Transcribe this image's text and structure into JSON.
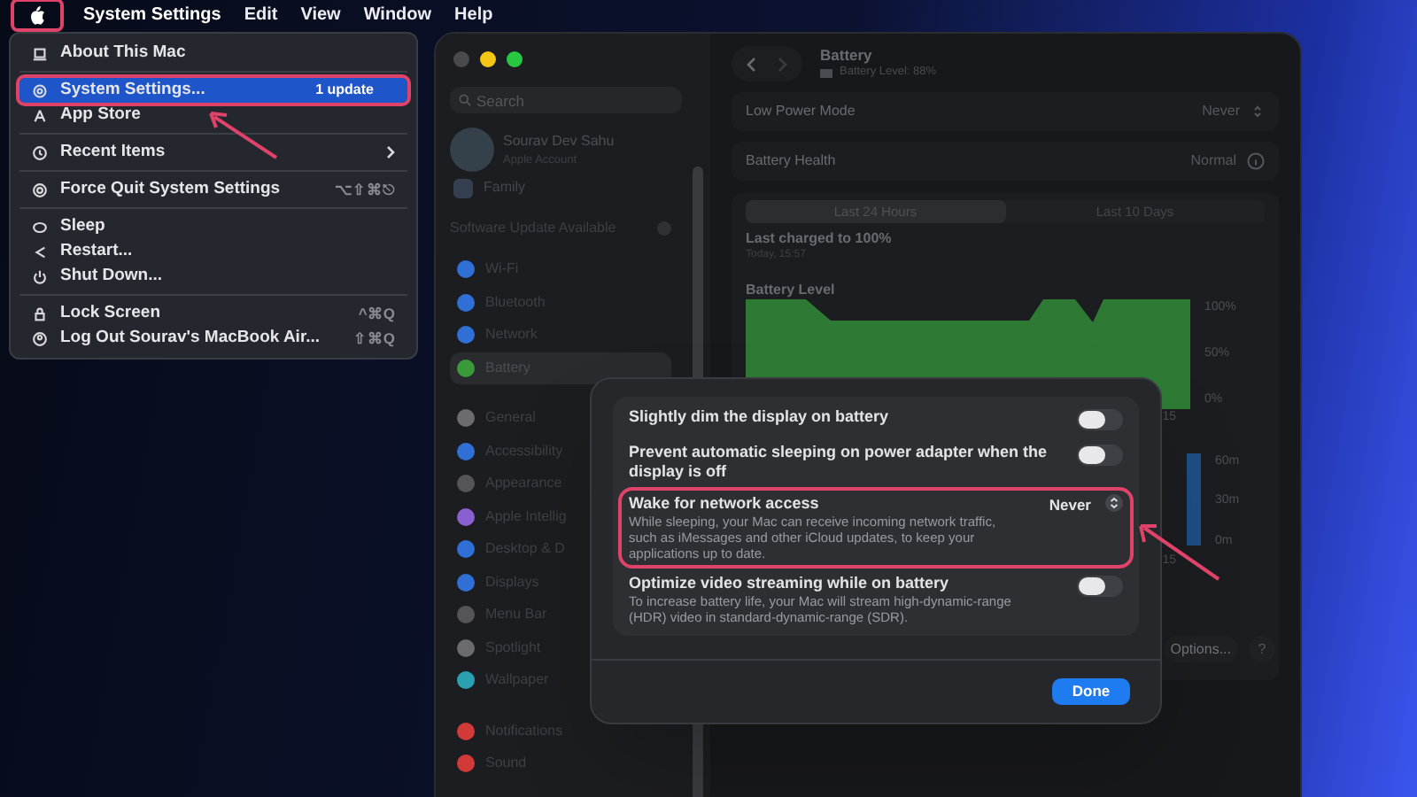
{
  "menu_bar": {
    "apple_highlighted": true,
    "items": [
      {
        "label": "System Settings",
        "kind": "app"
      },
      {
        "label": "Edit",
        "kind": "menu"
      },
      {
        "label": "View",
        "kind": "menu"
      },
      {
        "label": "Window",
        "kind": "menu"
      },
      {
        "label": "Help",
        "kind": "menu"
      }
    ]
  },
  "apple_menu": {
    "sections": [
      [
        {
          "label": "About This Mac",
          "selected": false,
          "highlighted": false
        }
      ],
      [
        {
          "label": "System Settings...",
          "badge": "1 update",
          "selected": true,
          "highlighted": true
        },
        {
          "label": "App Store",
          "selected": false,
          "highlighted": false
        }
      ],
      [
        {
          "label": "Recent Items",
          "submenu": true,
          "selected": false,
          "highlighted": false
        }
      ],
      [
        {
          "label": "Force Quit System Settings",
          "shortcut": "⌥⇧⌘⎋",
          "selected": false,
          "highlighted": false
        }
      ],
      [
        {
          "label": "Sleep",
          "selected": false,
          "highlighted": false
        },
        {
          "label": "Restart...",
          "selected": false,
          "highlighted": false
        },
        {
          "label": "Shut Down...",
          "selected": false,
          "highlighted": false
        }
      ],
      [
        {
          "label": "Lock Screen",
          "shortcut": "^⌘Q",
          "selected": false,
          "highlighted": false
        },
        {
          "label": "Log Out Sourav's MacBook Air...",
          "shortcut": "⇧⌘Q",
          "selected": false,
          "highlighted": false
        }
      ]
    ]
  },
  "settings_window": {
    "sidebar": {
      "search": {
        "placeholder": "Search"
      },
      "account": {
        "name": "Sourav Dev Sahu",
        "subtitle": "Apple Account"
      },
      "family": "Family",
      "update_notice": "Software Update Available",
      "sections": [
        [
          {
            "label": "Wi-Fi",
            "color": "#2f6fd6",
            "selected": false
          },
          {
            "label": "Bluetooth",
            "color": "#2f6fd6",
            "selected": false
          },
          {
            "label": "Network",
            "color": "#2f6fd6",
            "selected": false
          },
          {
            "label": "Battery",
            "color": "#3a9a3a",
            "selected": true
          }
        ],
        [
          {
            "label": "General",
            "color": "#6b6b70",
            "selected": false
          },
          {
            "label": "Accessibility",
            "color": "#2f6fd6",
            "selected": false
          },
          {
            "label": "Appearance",
            "color": "#555559",
            "selected": false
          },
          {
            "label": "Apple Intellig",
            "color": "#8a5fd0",
            "selected": false
          },
          {
            "label": "Desktop & D",
            "color": "#2f6fd6",
            "selected": false
          },
          {
            "label": "Displays",
            "color": "#2f6fd6",
            "selected": false
          },
          {
            "label": "Menu Bar",
            "color": "#555559",
            "selected": false
          },
          {
            "label": "Spotlight",
            "color": "#6b6b70",
            "selected": false
          },
          {
            "label": "Wallpaper",
            "color": "#2aa0b0",
            "selected": false
          }
        ],
        [
          {
            "label": "Notifications",
            "color": "#d23a3a",
            "selected": false
          },
          {
            "label": "Sound",
            "color": "#d23a3a",
            "selected": false
          }
        ]
      ]
    },
    "header": {
      "title": "Battery",
      "subtitle": "Battery Level: 88%"
    },
    "rows": [
      {
        "kind": "popup",
        "label": "Low Power Mode",
        "value": "Never"
      },
      {
        "kind": "info",
        "label": "Battery Health",
        "value": "Normal"
      }
    ],
    "tabs": [
      {
        "label": "Last 24 Hours",
        "selected": true
      },
      {
        "label": "Last 10 Days",
        "selected": false
      }
    ],
    "last_charged": {
      "title": "Last charged to 100%",
      "time": "Today, 15:57"
    },
    "battery_chart": {
      "title": "Battery Level",
      "y_labels": [
        "100%",
        "50%",
        "0%"
      ],
      "x_label": "15"
    },
    "usage_chart": {
      "y_labels": [
        "60m",
        "30m",
        "0m"
      ],
      "x_label": "15"
    },
    "options_button": "Options...",
    "help_button": "?"
  },
  "sheet": {
    "rows": [
      {
        "kind": "toggle",
        "title": "Slightly dim the display on battery",
        "on": false,
        "highlighted": false
      },
      {
        "kind": "toggle",
        "title": "Prevent automatic sleeping on power adapter when the display is off",
        "on": false,
        "highlighted": false
      },
      {
        "kind": "popup",
        "title": "Wake for network access",
        "description": "While sleeping, your Mac can receive incoming network traffic, such as iMessages and other iCloud updates, to keep your applications up to date.",
        "value": "Never",
        "highlighted": true
      },
      {
        "kind": "toggle",
        "title": "Optimize video streaming while on battery",
        "description": "To increase battery life, your Mac will stream high-dynamic-range (HDR) video in standard-dynamic-range (SDR).",
        "on": false,
        "highlighted": false
      }
    ],
    "done_button": "Done"
  }
}
